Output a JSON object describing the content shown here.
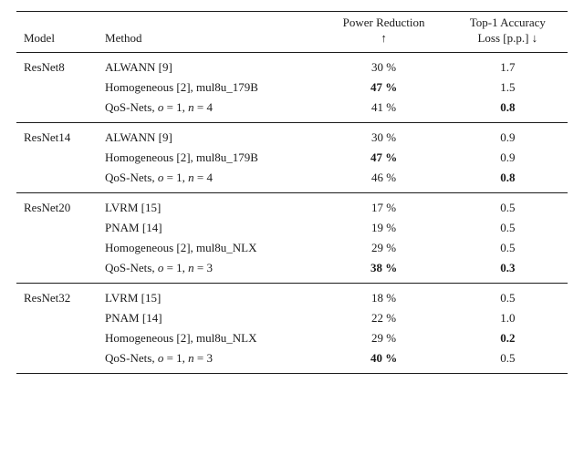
{
  "table": {
    "columns": [
      {
        "label": "Model",
        "key": "model"
      },
      {
        "label": "Method",
        "key": "method"
      },
      {
        "label": "Power Reduction\n↑",
        "key": "power"
      },
      {
        "label": "Top-1 Accuracy\nLoss [p.p.] ↓",
        "key": "acc"
      }
    ],
    "groups": [
      {
        "model": "ResNet8",
        "rows": [
          {
            "method": "ALWANN [9]",
            "power": "30 %",
            "power_bold": false,
            "acc": "1.7",
            "acc_bold": false
          },
          {
            "method": "Homogeneous [2], mu18u_179B",
            "power": "47 %",
            "power_bold": true,
            "acc": "1.5",
            "acc_bold": false
          },
          {
            "method": "QoS-Nets, o = 1, n = 4",
            "power": "41 %",
            "power_bold": false,
            "acc": "0.8",
            "acc_bold": true
          }
        ]
      },
      {
        "model": "ResNet14",
        "rows": [
          {
            "method": "ALWANN [9]",
            "power": "30 %",
            "power_bold": false,
            "acc": "0.9",
            "acc_bold": false
          },
          {
            "method": "Homogeneous [2], mu18u_179B",
            "power": "47 %",
            "power_bold": true,
            "acc": "0.9",
            "acc_bold": false
          },
          {
            "method": "QoS-Nets, o = 1, n = 4",
            "power": "46 %",
            "power_bold": false,
            "acc": "0.8",
            "acc_bold": true
          }
        ]
      },
      {
        "model": "ResNet20",
        "rows": [
          {
            "method": "LVRM [15]",
            "power": "17 %",
            "power_bold": false,
            "acc": "0.5",
            "acc_bold": false
          },
          {
            "method": "PNAM [14]",
            "power": "19 %",
            "power_bold": false,
            "acc": "0.5",
            "acc_bold": false
          },
          {
            "method": "Homogeneous [2], mu18u_NLX",
            "power": "29 %",
            "power_bold": false,
            "acc": "0.5",
            "acc_bold": false
          },
          {
            "method": "QoS-Nets, o = 1, n = 3",
            "power": "38 %",
            "power_bold": true,
            "acc": "0.3",
            "acc_bold": true
          }
        ]
      },
      {
        "model": "ResNet32",
        "rows": [
          {
            "method": "LVRM [15]",
            "power": "18 %",
            "power_bold": false,
            "acc": "0.5",
            "acc_bold": false
          },
          {
            "method": "PNAM [14]",
            "power": "22 %",
            "power_bold": false,
            "acc": "1.0",
            "acc_bold": false
          },
          {
            "method": "Homogeneous [2], mu18u_NLX",
            "power": "29 %",
            "power_bold": false,
            "acc": "0.2",
            "acc_bold": true
          },
          {
            "method": "QoS-Nets, o = 1, n = 3",
            "power": "40 %",
            "power_bold": true,
            "acc": "0.5",
            "acc_bold": false
          }
        ]
      }
    ]
  }
}
